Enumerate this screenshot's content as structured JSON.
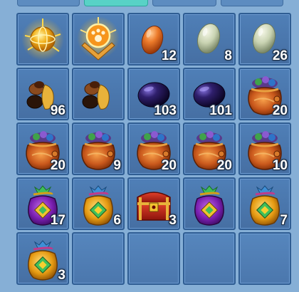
{
  "inventory": {
    "slots": [
      {
        "icon": "golden-orb-icon",
        "count": ""
      },
      {
        "icon": "paw-emblem-icon",
        "count": ""
      },
      {
        "icon": "orange-egg-icon",
        "count": "12"
      },
      {
        "icon": "pale-green-egg-icon",
        "count": "8"
      },
      {
        "icon": "pale-green-egg-icon",
        "count": "26"
      },
      {
        "icon": "seeds-icon",
        "count": "96"
      },
      {
        "icon": "seeds-icon",
        "count": ""
      },
      {
        "icon": "dark-purple-egg-icon",
        "count": "103"
      },
      {
        "icon": "dark-purple-egg-icon",
        "count": "101"
      },
      {
        "icon": "loot-bag-icon",
        "count": "20"
      },
      {
        "icon": "loot-bag-icon",
        "count": "20"
      },
      {
        "icon": "loot-bag-icon",
        "count": "9"
      },
      {
        "icon": "loot-bag-icon",
        "count": "20"
      },
      {
        "icon": "loot-bag-icon",
        "count": "20"
      },
      {
        "icon": "loot-bag-icon",
        "count": "10"
      },
      {
        "icon": "purple-pouch-icon",
        "count": "17"
      },
      {
        "icon": "gold-pouch-icon",
        "count": "6"
      },
      {
        "icon": "red-chest-icon",
        "count": "3"
      },
      {
        "icon": "purple-pouch-icon",
        "count": ""
      },
      {
        "icon": "gold-pouch-icon",
        "count": "7"
      },
      {
        "icon": "gold-pouch-icon",
        "count": "3"
      },
      {
        "icon": "empty-slot",
        "count": ""
      },
      {
        "icon": "empty-slot",
        "count": ""
      },
      {
        "icon": "empty-slot",
        "count": ""
      },
      {
        "icon": "empty-slot",
        "count": ""
      }
    ]
  },
  "colors": {
    "background": "#86afd6",
    "slot": "#4f7fb7",
    "active_tab": "#58d2c6"
  }
}
